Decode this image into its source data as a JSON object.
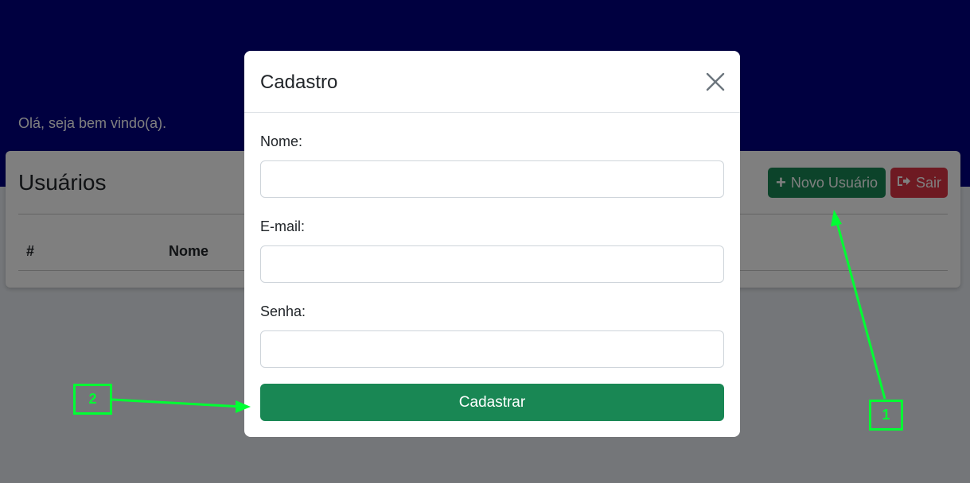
{
  "page": {
    "welcome_text": "Olá, seja bem vindo(a).",
    "card_title": "Usuários",
    "table_headers": [
      "#",
      "Nome"
    ],
    "new_user_button": "Novo Usuário",
    "exit_button": "Sair",
    "new_user_icon": "plus-icon",
    "exit_icon": "sign-out-icon"
  },
  "modal": {
    "title": "Cadastro",
    "close_icon": "close-icon",
    "fields": [
      {
        "label": "Nome:",
        "value": "",
        "placeholder": ""
      },
      {
        "label": "E-mail:",
        "value": "",
        "placeholder": ""
      },
      {
        "label": "Senha:",
        "value": "",
        "placeholder": ""
      }
    ],
    "submit_button": "Cadastrar"
  },
  "annotations": [
    {
      "label": "1"
    },
    {
      "label": "2"
    }
  ],
  "colors": {
    "header_band": "#000080",
    "success": "#198754",
    "danger": "#dc3545",
    "annotation": "#00ff33"
  }
}
